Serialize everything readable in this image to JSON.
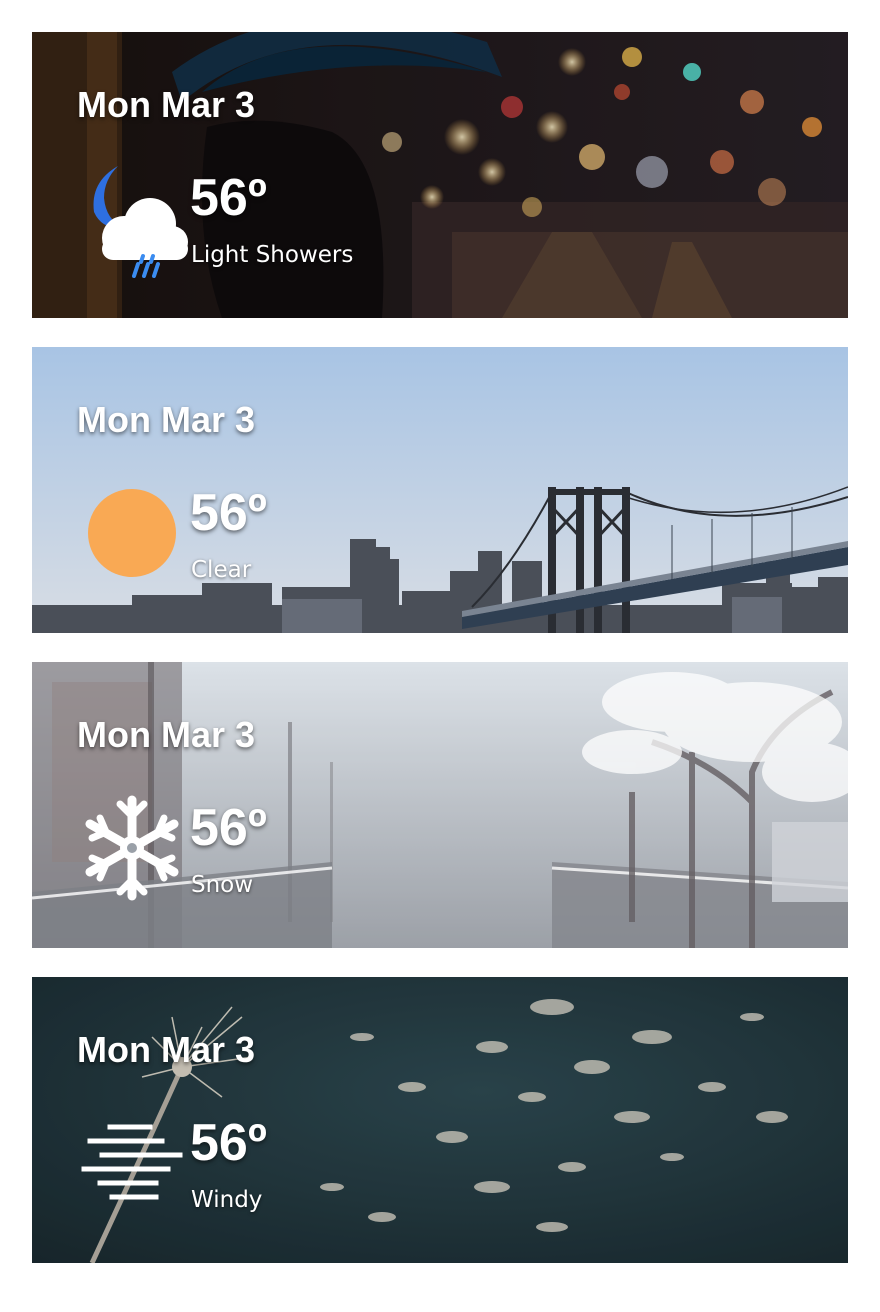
{
  "forecasts": [
    {
      "date": "Mon Mar 3",
      "temp": "56º",
      "condition": "Light Showers",
      "icon": "moon-cloud-showers-icon",
      "background": "night-city-rain-umbrella"
    },
    {
      "date": "Mon Mar 3",
      "temp": "56º",
      "condition": "Clear",
      "icon": "sun-icon",
      "background": "city-bridge-clear-sky"
    },
    {
      "date": "Mon Mar 3",
      "temp": "56º",
      "condition": "Snow",
      "icon": "snowflake-icon",
      "background": "snowy-street"
    },
    {
      "date": "Mon Mar 3",
      "temp": "56º",
      "condition": "Windy",
      "icon": "wind-lines-icon",
      "background": "dandelion-seeds-wind"
    }
  ],
  "colors": {
    "text": "#ffffff",
    "sun": "#f9a954",
    "rain": "#3b8cf0",
    "moon": "#2e6fe0"
  }
}
